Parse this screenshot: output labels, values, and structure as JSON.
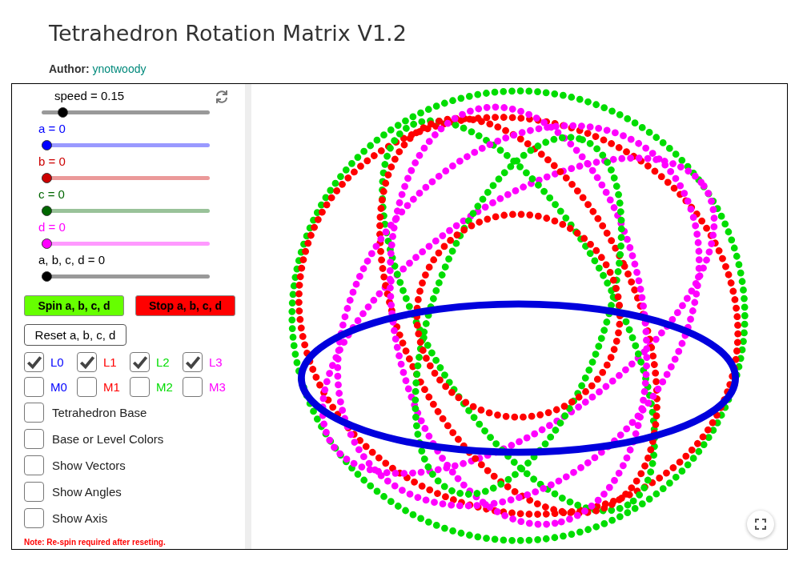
{
  "title": "Tetrahedron Rotation Matrix V1.2",
  "author": {
    "label": "Author:",
    "name": "ynotwoody"
  },
  "sliders": [
    {
      "label": "speed = 0.15",
      "level": 0.1,
      "color": "#000000"
    },
    {
      "label": "a = 0",
      "level": 0,
      "color": "#0000ff"
    },
    {
      "label": "b = 0",
      "level": 0,
      "color": "#cc0000"
    },
    {
      "label": "c = 0",
      "level": 0,
      "color": "#006600"
    },
    {
      "label": "d = 0",
      "level": 0,
      "color": "#ff00ff"
    },
    {
      "label": "a, b, c, d = 0",
      "level": 0,
      "color": "#000000"
    }
  ],
  "action_buttons": [
    {
      "label": "Spin a, b, c, d",
      "color": "#66ff00"
    },
    {
      "label": "Stop a, b, c, d",
      "color": "#ff0000"
    }
  ],
  "reset_button": "Reset a, b, c, d",
  "grid_checkboxes": [
    {
      "label": "L0",
      "checked": true,
      "color": "#0000ff"
    },
    {
      "label": "L1",
      "checked": true,
      "color": "#ff0000"
    },
    {
      "label": "L2",
      "checked": true,
      "color": "#00dd00"
    },
    {
      "label": "L3",
      "checked": true,
      "color": "#ff00ff"
    },
    {
      "label": "M0",
      "checked": false,
      "color": "#0000ff"
    },
    {
      "label": "M1",
      "checked": false,
      "color": "#ff0000"
    },
    {
      "label": "M2",
      "checked": false,
      "color": "#00dd00"
    },
    {
      "label": "M3",
      "checked": false,
      "color": "#ff00ff"
    }
  ],
  "options": [
    {
      "label": "Tetrahedron Base",
      "checked": false
    },
    {
      "label": "Base or Level Colors",
      "checked": false
    },
    {
      "label": "Show Vectors",
      "checked": false
    },
    {
      "label": "Show Angles",
      "checked": false
    },
    {
      "label": "Show Axis",
      "checked": false
    }
  ],
  "note": "Note: Re-spin required after reseting."
}
